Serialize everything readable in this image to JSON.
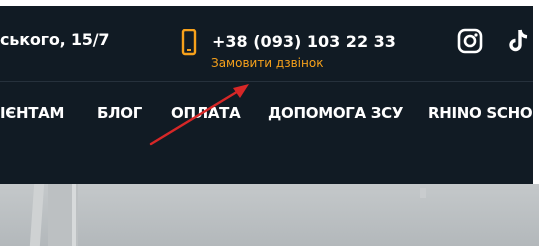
{
  "header": {
    "address": "ського, 15/7",
    "phone_icon": "smartphone-icon",
    "phone": "+38 (093) 103 22 33",
    "callback": "Замовити дзвінок",
    "social": [
      "instagram-icon",
      "tiktok-icon"
    ]
  },
  "nav": {
    "items": [
      "ІЄНТАМ",
      "БЛОГ",
      "ОПЛАТА",
      "ДОПОМОГА ЗСУ",
      "RHINO SCHOO"
    ]
  },
  "annotation": {
    "arrow_color": "#d62727"
  },
  "colors": {
    "header_bg": "#111b24",
    "accent": "#f7a11b",
    "text": "#ffffff"
  }
}
